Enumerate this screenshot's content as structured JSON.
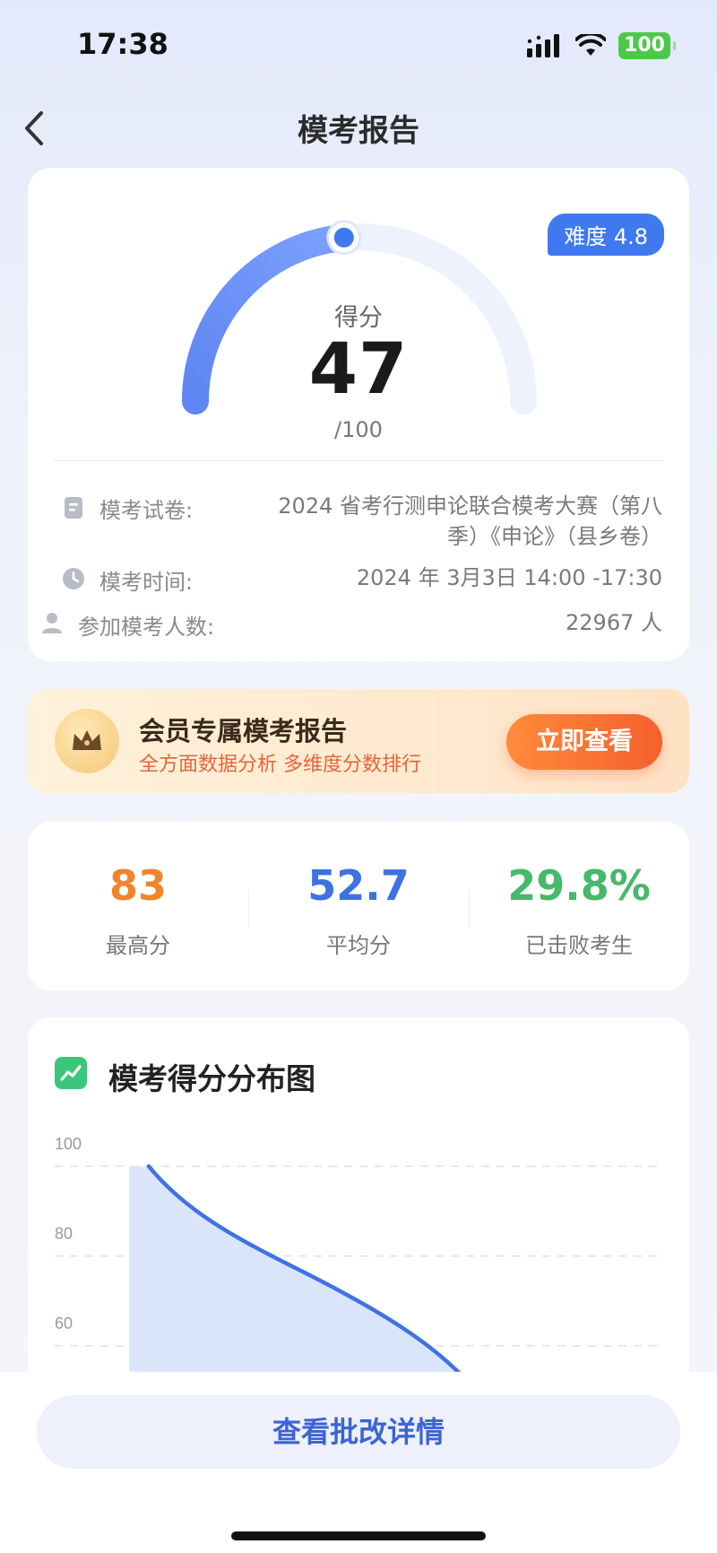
{
  "status_bar": {
    "time": "17:38",
    "battery": "100"
  },
  "nav": {
    "title": "模考报告"
  },
  "score": {
    "difficulty": "难度 4.8",
    "label": "得分",
    "value": "47",
    "total": "/100",
    "fraction": 0.47
  },
  "exam_info": {
    "paper_label": "模考试卷:",
    "paper_value_line1": "2024 省考行测申论联合模考大赛（第八",
    "paper_value_line2": "季）《申论》（县乡卷）",
    "time_label": "模考时间:",
    "time_value": "2024 年 3月3日 14:00 -17:30",
    "participants_label": "参加模考人数:",
    "participants_value": "22967 人"
  },
  "vip_banner": {
    "title": "会员专属模考报告",
    "subtitle": "全方面数据分析  多维度分数排行",
    "button": "立即查看"
  },
  "stats": [
    {
      "value": "83",
      "label": "最高分",
      "color": "#f0852d"
    },
    {
      "value": "52.7",
      "label": "平均分",
      "color": "#3d72e0"
    },
    {
      "value": "29.8%",
      "label": "已击败考生",
      "color": "#46b96a"
    }
  ],
  "chart_data": {
    "type": "area",
    "title": "模考得分分布图",
    "y_ticks": [
      "100",
      "80",
      "60"
    ],
    "ylim": [
      0,
      100
    ],
    "grid": true
  },
  "bottom": {
    "button": "查看批改详情"
  },
  "colors": {
    "accent": "#3f79f0",
    "orange": "#f4602c",
    "green": "#46b96a"
  }
}
